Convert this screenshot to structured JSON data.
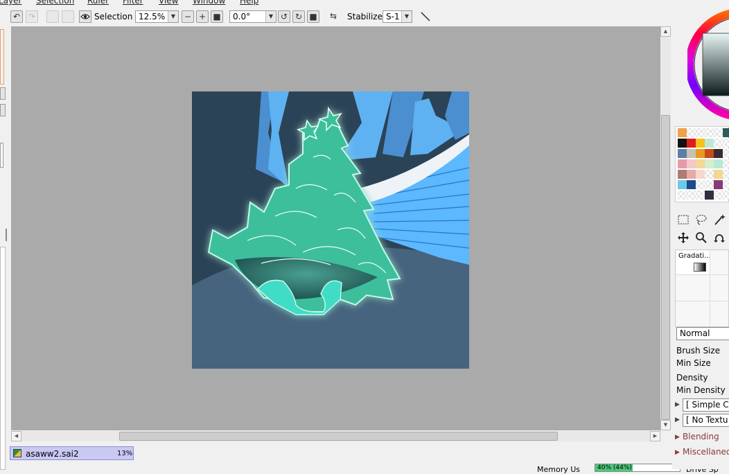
{
  "menubar": {
    "items": [
      "Layer",
      "Selection",
      "Ruler",
      "Filter",
      "View",
      "Window",
      "Help"
    ]
  },
  "toolbar": {
    "selection_label": "Selection",
    "zoom_value": "12.5%",
    "angle_value": "0.0°",
    "stabilizer_label": "Stabilizer",
    "stabilizer_value": "S-1"
  },
  "document": {
    "filename": "asaww2.sai2",
    "zoom": "13%"
  },
  "brush_panel": {
    "gradation_label": "Gradati...",
    "blend_mode": "Normal",
    "brush_size_label": "Brush Size",
    "min_size_label": "Min Size",
    "density_label": "Density",
    "min_density_label": "Min Density",
    "shape_value": "[ Simple Cir",
    "texture_value": "[ No Textu",
    "blending_label": "Blending",
    "misc_label": "Miscellaneou"
  },
  "statusbar": {
    "memory_label": "Memory Us",
    "memory_value": "40% (44%)",
    "drive_label": "Drive Sp"
  },
  "colors": {
    "accent_tab": "#c9c9f3",
    "canvas_bg": "#aaaaaa",
    "swatches": [
      [
        "#f2a04a",
        "",
        "",
        "",
        "",
        "#2f5a5a"
      ],
      [
        "#111111",
        "#dd1e1e",
        "#f5c11a",
        "#bfe8d8",
        "",
        ""
      ],
      [
        "#5a7fa8",
        "#c8c0b4",
        "#e89a1c",
        "#c84a18",
        "#3a2a33",
        ""
      ],
      [
        "#e89aa8",
        "#f4c8c8",
        "#f3d89a",
        "#d8edc8",
        "#b8e8d8",
        ""
      ],
      [
        "#b07a74",
        "#e8aaa4",
        "#f6d8cc",
        "",
        "#f2d890",
        ""
      ],
      [
        "#6ec8e8",
        "#1e4a8a",
        "",
        "",
        "#8a3a7a",
        ""
      ],
      [
        "",
        "",
        "",
        "#2e3040",
        "",
        ""
      ]
    ]
  }
}
